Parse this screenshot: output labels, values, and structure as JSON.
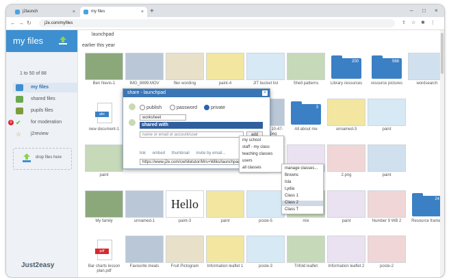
{
  "browser": {
    "tabs": [
      {
        "label": "j2launch",
        "active": false
      },
      {
        "label": "my files",
        "active": true
      }
    ],
    "url": "j2e.com/myfiles"
  },
  "sidebar": {
    "title": "my files",
    "count": "1 to 50 of 88",
    "items": [
      {
        "label": "my files",
        "icon": "folder-icon",
        "selected": true
      },
      {
        "label": "shared files",
        "icon": "people-icon",
        "selected": false
      },
      {
        "label": "pupils files",
        "icon": "pupils-icon",
        "selected": false
      },
      {
        "label": "for moderation",
        "icon": "check-icon",
        "selected": false,
        "badge": "0"
      },
      {
        "label": "j2review",
        "icon": "star-icon",
        "selected": false
      }
    ],
    "drop_label": "drop files here",
    "brand": "Just2easy"
  },
  "main": {
    "top_caption": "launchpad",
    "section": "earlier this year",
    "tiles": [
      {
        "cap": "Ben Nevis-1"
      },
      {
        "cap": "IMG_8699.MOV"
      },
      {
        "cap": "flier wording"
      },
      {
        "cap": "paint-4"
      },
      {
        "cap": "JIT bucket list"
      },
      {
        "cap": "Shell patterns"
      },
      {
        "cap": "Library resources",
        "folder": "200"
      },
      {
        "cap": "resource pictures",
        "folder": "568"
      },
      {
        "cap": "wordsearch"
      },
      {
        "cap": "new document-1",
        "doc": "abc"
      },
      {
        "cap": "2022-06-10_10-47-08_000.jpeg"
      },
      {
        "cap": "All about me",
        "folder": "3"
      },
      {
        "cap": "unnamed-3"
      },
      {
        "cap": "paint"
      },
      {
        "cap": "paint"
      },
      {
        "cap": "My home.png"
      },
      {
        "cap": "2.png"
      },
      {
        "cap": "paint"
      },
      {
        "cap": "My family"
      },
      {
        "cap": "unnamed-1"
      },
      {
        "cap": "paint-3",
        "big": "Hello"
      },
      {
        "cap": "paint"
      },
      {
        "cap": "poste-5"
      },
      {
        "cap": "mix"
      },
      {
        "cap": "paint"
      },
      {
        "cap": "Number 9 WB 2"
      },
      {
        "cap": "Resource frames",
        "folder": "24"
      },
      {
        "cap": "Bar charts lesson plan.pdf",
        "doc": "pdf"
      },
      {
        "cap": "Favourite meals"
      },
      {
        "cap": "Fruit Pictogram"
      },
      {
        "cap": "Information leaflet 1"
      },
      {
        "cap": "poste-3"
      },
      {
        "cap": "Trifold leaflet"
      },
      {
        "cap": "Information leaflet 2"
      },
      {
        "cap": "poste-2"
      }
    ]
  },
  "dialog": {
    "title": "share - launchpad",
    "radios": [
      "publish",
      "password",
      "private"
    ],
    "selected_radio": "private",
    "select_value": "worksheet",
    "shared_with": "shared with",
    "email_placeholder": "name or email or account/user",
    "add_label": "add",
    "links": [
      "link",
      "embed",
      "thumbnail",
      "invite by email..."
    ],
    "share_url": "https://www.j2e.com/cwhitetutor/Mrs+Wilks/launchpad"
  },
  "menu1": {
    "items": [
      "my school",
      "staff - my class",
      "teaching classes",
      "users",
      "all classes"
    ]
  },
  "menu2": {
    "items": [
      "manage classes...",
      "Browns",
      "Isla",
      "Lydia",
      "Class 1",
      "Class 2",
      "Class T"
    ],
    "highlighted": "Class 2"
  },
  "colors": {
    "accent": "#3d8fd0",
    "dialog_title": "#3a75b5",
    "folder": "#3b7fc4",
    "badge": "#d9272e"
  }
}
